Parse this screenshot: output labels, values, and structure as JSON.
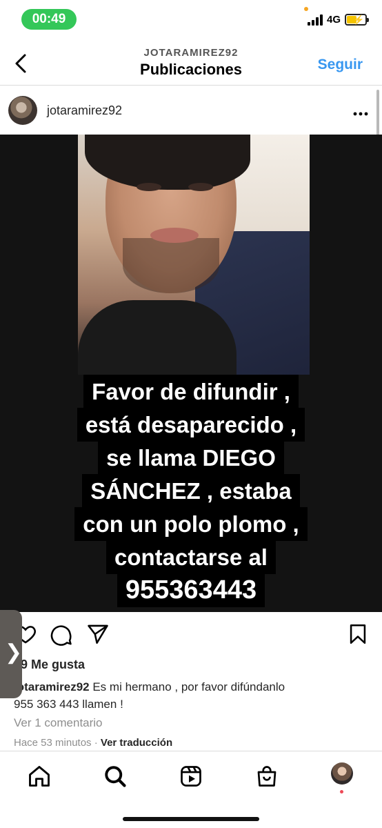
{
  "status_bar": {
    "time": "00:49",
    "network": "4G",
    "accent_color": "#34c759"
  },
  "header": {
    "account": "JOTARAMIREZ92",
    "title": "Publicaciones",
    "follow_label": "Seguir",
    "follow_color": "#3897f0",
    "back_icon": "chevron-left-icon"
  },
  "post": {
    "username": "jotaramirez92",
    "more_icon": "more-horizontal-icon",
    "image_text_lines": [
      "Favor de difundir ,",
      "está desaparecido ,",
      "se llama DIEGO",
      "SÁNCHEZ  , estaba",
      "con un polo plomo ,",
      "contactarse al",
      "955363443"
    ],
    "likes": "9 Me gusta",
    "caption_user": "jotaramirez92",
    "caption_text": " Es mi hermano , por favor difúndanlo",
    "caption_text_2": "955 363 443 llamen !",
    "view_comments": "Ver 1 comentario",
    "time_ago": "Hace 53 minutos",
    "separator": "·",
    "translate": "Ver traducción"
  },
  "actions": {
    "like_icon": "heart-icon",
    "comment_icon": "comment-icon",
    "share_icon": "send-icon",
    "save_icon": "bookmark-icon"
  },
  "side_tab": {
    "label": "❯"
  },
  "bottom_nav": {
    "items": [
      "home-icon",
      "search-icon",
      "reels-icon",
      "shop-icon",
      "profile-avatar"
    ],
    "notification_color": "#ed4956"
  }
}
